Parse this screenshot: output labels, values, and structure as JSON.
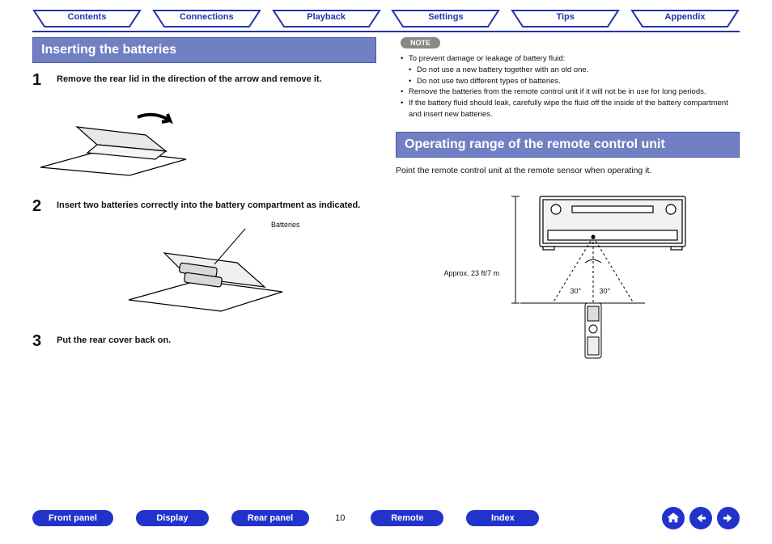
{
  "tabs": [
    "Contents",
    "Connections",
    "Playback",
    "Settings",
    "Tips",
    "Appendix"
  ],
  "left": {
    "heading": "Inserting the batteries",
    "steps": [
      {
        "n": "1",
        "t": "Remove the rear lid in the direction of the arrow and remove it."
      },
      {
        "n": "2",
        "t": "Insert two batteries correctly into the battery compartment as indicated."
      },
      {
        "n": "3",
        "t": "Put the rear cover back on."
      }
    ],
    "batteries_label": "Batteries"
  },
  "right": {
    "note_label": "NOTE",
    "notes": [
      "To prevent damage or leakage of battery fluid:",
      "Do not use a new battery together with an old one.",
      "Do not use two different types of batteries.",
      "Remove the batteries from the remote control unit if it will not be in use for long periods.",
      "If the battery fluid should leak, carefully wipe the fluid off the inside of the battery compartment and insert new batteries."
    ],
    "heading": "Operating range of the remote control unit",
    "range_text": "Point the remote control unit at the remote sensor when operating it.",
    "distance": "Approx. 23 ft/7 m",
    "deg_left": "30°",
    "deg_right": "30°"
  },
  "footer": {
    "buttons": [
      "Front panel",
      "Display",
      "Rear panel",
      "Remote",
      "Index"
    ],
    "page": "10"
  }
}
